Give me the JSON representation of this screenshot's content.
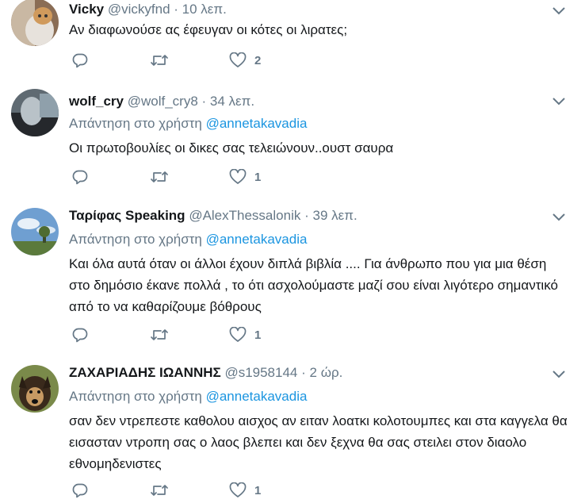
{
  "tweets": [
    {
      "name": "Vicky",
      "handle": "@vickyfnd",
      "time": "10 λεπ.",
      "reply_prefix": "",
      "reply_mention": "",
      "text": "Αν διαφωνούσε ας έφευγαν οι κότες οι λιρατες;",
      "replies": "",
      "retweets": "",
      "likes": "2",
      "avatar": "cat"
    },
    {
      "name": "wolf_cry",
      "handle": "@wolf_cry8",
      "time": "34 λεπ.",
      "reply_prefix": "Απάντηση στο χρήστη",
      "reply_mention": "@annetakavadia",
      "text": "Οι πρωτοβουλίες οι δικες σας τελειώνουν..ουστ σαυρα",
      "replies": "",
      "retweets": "",
      "likes": "1",
      "avatar": "face"
    },
    {
      "name": "Ταρίφας Speaking",
      "handle": "@AlexThessalonik",
      "time": "39 λεπ.",
      "reply_prefix": "Απάντηση στο χρήστη",
      "reply_mention": "@annetakavadia",
      "text": "Και όλα αυτά όταν οι άλλοι έχουν διπλά βιβλία .... Για άνθρωπο που για μια θέση στο δημόσιο έκανε πολλά , το ότι ασχολούμαστε μαζί σου είναι λιγότερο σημαντικό από το να καθαρίζουμε βόθρους",
      "replies": "",
      "retweets": "",
      "likes": "1",
      "avatar": "sky"
    },
    {
      "name": "ΖΑΧΑΡΙΑΔΗΣ ΙΩΑΝΝΗΣ",
      "handle": "@s1958144",
      "time": "2 ώρ.",
      "reply_prefix": "Απάντηση στο χρήστη",
      "reply_mention": "@annetakavadia",
      "text": "σαν δεν ντρεπεστε καθολου αισχος αν ειταν λοατκι κολοτουμπες  και στα καγγελα θα εισασταν ντροπη σας ο λαος βλεπει και δεν ξεχνα θα σας στειλει στον διαολο εθνομηδενιστες",
      "replies": "",
      "retweets": "",
      "likes": "1",
      "avatar": "dog"
    }
  ],
  "separator": "·",
  "icons": {
    "reply": "reply-icon",
    "retweet": "retweet-icon",
    "like": "like-icon",
    "caret": "chevron-down-icon"
  },
  "colors": {
    "text": "#14171a",
    "secondary": "#657786",
    "link": "#1b95e0",
    "divider": "#e6ecf0"
  }
}
